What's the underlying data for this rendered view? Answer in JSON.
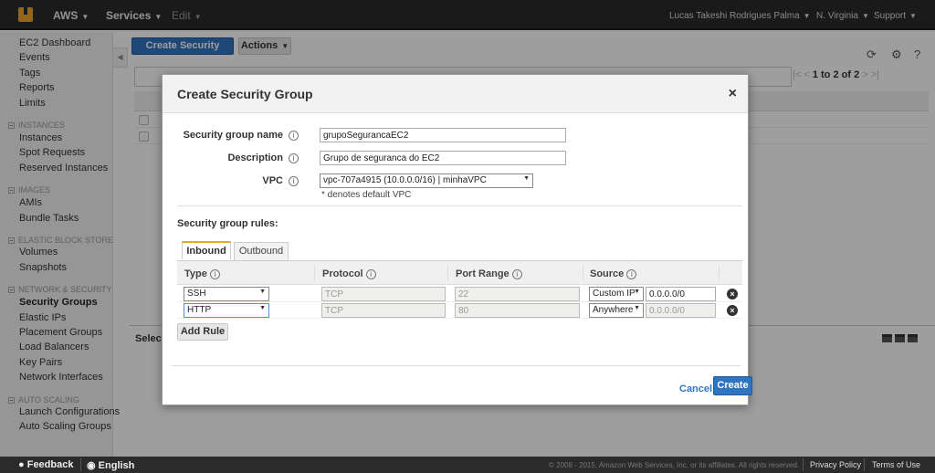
{
  "topnav": {
    "brand": "AWS",
    "services": "Services",
    "edit": "Edit",
    "user": "Lucas Takeshi Rodrigues Palma",
    "region": "N. Virginia",
    "support": "Support"
  },
  "sidebar": {
    "links_top": [
      "EC2 Dashboard",
      "Events",
      "Tags",
      "Reports",
      "Limits"
    ],
    "sec_instances": "INSTANCES",
    "instances": [
      "Instances",
      "Spot Requests",
      "Reserved Instances"
    ],
    "sec_images": "IMAGES",
    "images": [
      "AMIs",
      "Bundle Tasks"
    ],
    "sec_ebs": "ELASTIC BLOCK STORE",
    "ebs": [
      "Volumes",
      "Snapshots"
    ],
    "sec_network": "NETWORK & SECURITY",
    "network": [
      "Security Groups",
      "Elastic IPs",
      "Placement Groups",
      "Load Balancers",
      "Key Pairs",
      "Network Interfaces"
    ],
    "sec_autoscaling": "AUTO SCALING",
    "autoscaling": [
      "Launch Configurations",
      "Auto Scaling Groups"
    ]
  },
  "toolbar": {
    "create_label": "Create Security Group",
    "actions_label": "Actions"
  },
  "pager": {
    "text": "1 to 2 of 2"
  },
  "background": {
    "select_text": "Select"
  },
  "modal": {
    "title": "Create Security Group",
    "close": "×",
    "name_label": "Security group name",
    "name_value": "grupoSegurancaEC2",
    "desc_label": "Description",
    "desc_value": "Grupo de seguranca do EC2",
    "vpc_label": "VPC",
    "vpc_value": "vpc-707a4915 (10.0.0.0/16) | minhaVPC",
    "vpc_note": "* denotes default VPC",
    "rules_label": "Security group rules:",
    "tab_inbound": "Inbound",
    "tab_outbound": "Outbound",
    "columns": [
      "Type",
      "Protocol",
      "Port Range",
      "Source"
    ],
    "rules": [
      {
        "type": "SSH",
        "protocol": "TCP",
        "port": "22",
        "source_type": "Custom IP",
        "source": "0.0.0.0/0"
      },
      {
        "type": "HTTP",
        "protocol": "TCP",
        "port": "80",
        "source_type": "Anywhere",
        "source": "0.0.0.0/0"
      }
    ],
    "add_rule": "Add Rule",
    "cancel": "Cancel",
    "create": "Create"
  },
  "footer": {
    "feedback": "Feedback",
    "language": "English",
    "copyright": "© 2008 - 2015, Amazon Web Services, Inc. or its affiliates. All rights reserved.",
    "privacy": "Privacy Policy",
    "terms": "Terms of Use"
  },
  "colors": {
    "primary": "#2f74c0",
    "nav": "#2b2b2b",
    "tab_accent": "#f0a32d"
  }
}
